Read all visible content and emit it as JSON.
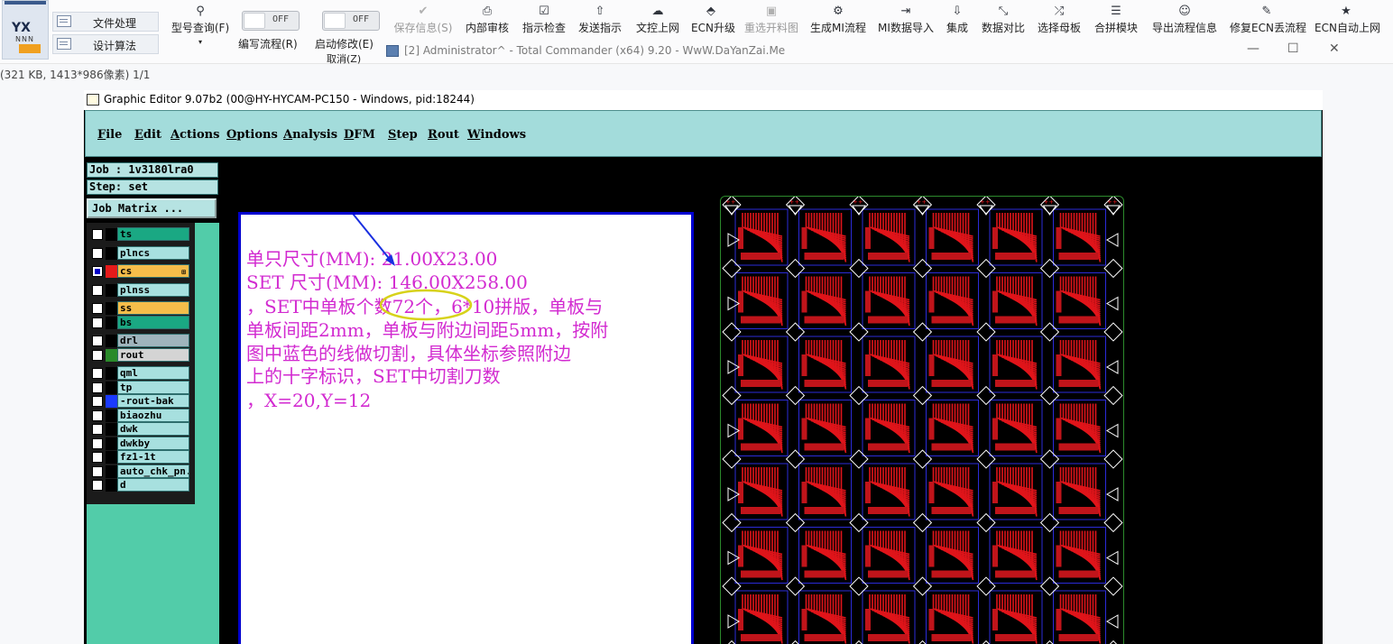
{
  "toolbar": {
    "logo": "YX",
    "logo_sub": "NNN",
    "side_buttons": [
      "文件处理",
      "设计算法"
    ],
    "model_query": "型号查询(F)",
    "toggles": [
      {
        "label": "编写流程(R)",
        "state": "OFF"
      },
      {
        "label": "启动修改(E)",
        "label2": "取消(Z)",
        "state": "OFF"
      }
    ],
    "buttons": [
      {
        "label": "保存信息(S)",
        "icon": "check-icon",
        "glyph": "✔",
        "disabled": true
      },
      {
        "label": "内部审核",
        "icon": "printer-icon",
        "glyph": "⎙",
        "disabled": false
      },
      {
        "label": "指示检查",
        "icon": "checkbox-icon",
        "glyph": "☑",
        "disabled": false
      },
      {
        "label": "发送指示",
        "icon": "upload-icon",
        "glyph": "⇧",
        "disabled": false
      },
      {
        "label": "文控上网",
        "icon": "cloud-upload-icon",
        "glyph": "☁",
        "disabled": false
      },
      {
        "label": "ECN升级",
        "icon": "upgrade-icon",
        "glyph": "⬘",
        "disabled": false
      },
      {
        "label": "重选开料图",
        "icon": "image-icon",
        "glyph": "▣",
        "disabled": true
      },
      {
        "label": "生成MI流程",
        "icon": "gears-icon",
        "glyph": "⚙",
        "disabled": false
      },
      {
        "label": "MI数据导入",
        "icon": "import-icon",
        "glyph": "⇥",
        "disabled": false
      },
      {
        "label": "集成",
        "icon": "download-icon",
        "glyph": "⇩",
        "disabled": false
      },
      {
        "label": "数据对比",
        "icon": "compress-icon",
        "glyph": "⤡",
        "disabled": false
      },
      {
        "label": "选择母板",
        "icon": "shuffle-icon",
        "glyph": "⤮",
        "disabled": false
      },
      {
        "label": "合拼模块",
        "icon": "list-icon",
        "glyph": "☰",
        "disabled": false
      },
      {
        "label": "导出流程信息",
        "icon": "smile-icon",
        "glyph": "☺",
        "disabled": false
      },
      {
        "label": "修复ECN丢流程",
        "icon": "wrench-icon",
        "glyph": "✎",
        "disabled": false
      },
      {
        "label": "ECN自动上网",
        "icon": "star-icon",
        "glyph": "★",
        "disabled": false
      }
    ]
  },
  "total_commander": {
    "title": "[2] Administrator^ - Total Commander (x64) 9.20 - WwW.DaYanZai.Me",
    "minimize": "—",
    "maximize": "☐",
    "close": "✕"
  },
  "status_line": "(321 KB, 1413*986像素) 1/1",
  "graphic_editor": {
    "title": "Graphic Editor 9.07b2 (00@HY-HYCAM-PC150 - Windows, pid:18244)",
    "menu": [
      "File",
      "Edit",
      "Actions",
      "Options",
      "Analysis",
      "DFM",
      "Step",
      "Rout",
      "Windows"
    ],
    "job": "Job : 1v3180lra0",
    "step": "Step: set",
    "job_matrix": "Job Matrix ...",
    "layers": [
      {
        "name": "ts",
        "checked": false,
        "swatch": "#000000",
        "bg": "#1aa883"
      },
      {
        "name": "plncs",
        "checked": false,
        "swatch": "#000000",
        "bg": "#a7e0df"
      },
      {
        "name": "cs",
        "checked": true,
        "swatch": "#e61a1a",
        "bg": "#f5bd4a",
        "arrow": "⊞"
      },
      {
        "name": "plnss",
        "checked": false,
        "swatch": "#000000",
        "bg": "#a7e0df"
      },
      {
        "name": "ss",
        "checked": false,
        "swatch": "#000000",
        "bg": "#f5bd4a"
      },
      {
        "name": "bs",
        "checked": false,
        "swatch": "#000000",
        "bg": "#1aa883"
      },
      {
        "name": "drl",
        "checked": false,
        "swatch": "#000000",
        "bg": "#9fb4bc"
      },
      {
        "name": "rout",
        "checked": false,
        "swatch": "#2a8a2a",
        "bg": "#d4d4d4"
      },
      {
        "name": "qml",
        "checked": false,
        "swatch": "#000000",
        "bg": "#a7e0df"
      },
      {
        "name": "tp",
        "checked": false,
        "swatch": "#000000",
        "bg": "#a7e0df"
      },
      {
        "name": "-rout-bak",
        "checked": false,
        "swatch": "#1a3aff",
        "bg": "#a7e0df"
      },
      {
        "name": "biaozhu",
        "checked": false,
        "swatch": "#000000",
        "bg": "#a7e0df"
      },
      {
        "name": "dwk",
        "checked": false,
        "swatch": "#000000",
        "bg": "#a7e0df"
      },
      {
        "name": "dwkby",
        "checked": false,
        "swatch": "#000000",
        "bg": "#a7e0df"
      },
      {
        "name": "fz1-1t",
        "checked": false,
        "swatch": "#000000",
        "bg": "#a7e0df"
      },
      {
        "name": "auto_chk_pn.",
        "checked": false,
        "swatch": "#000000",
        "bg": "#a7e0df"
      },
      {
        "name": "d",
        "checked": false,
        "swatch": "#000000",
        "bg": "#a7e0df"
      }
    ],
    "note_lines": [
      "单只尺寸(MM): 21.00X23.00",
      "SET 尺寸(MM): 146.00X258.00",
      "，SET中单板个数72个，6*10拼版，单板与",
      "单板间距2mm，单板与附边间距5mm，按附",
      "图中蓝色的线做切割，具体坐标参照附边",
      "上的十字标识，SET中切割刀数",
      "，X=20,Y=12"
    ],
    "board": {
      "cols": 6,
      "rows": 7
    }
  }
}
